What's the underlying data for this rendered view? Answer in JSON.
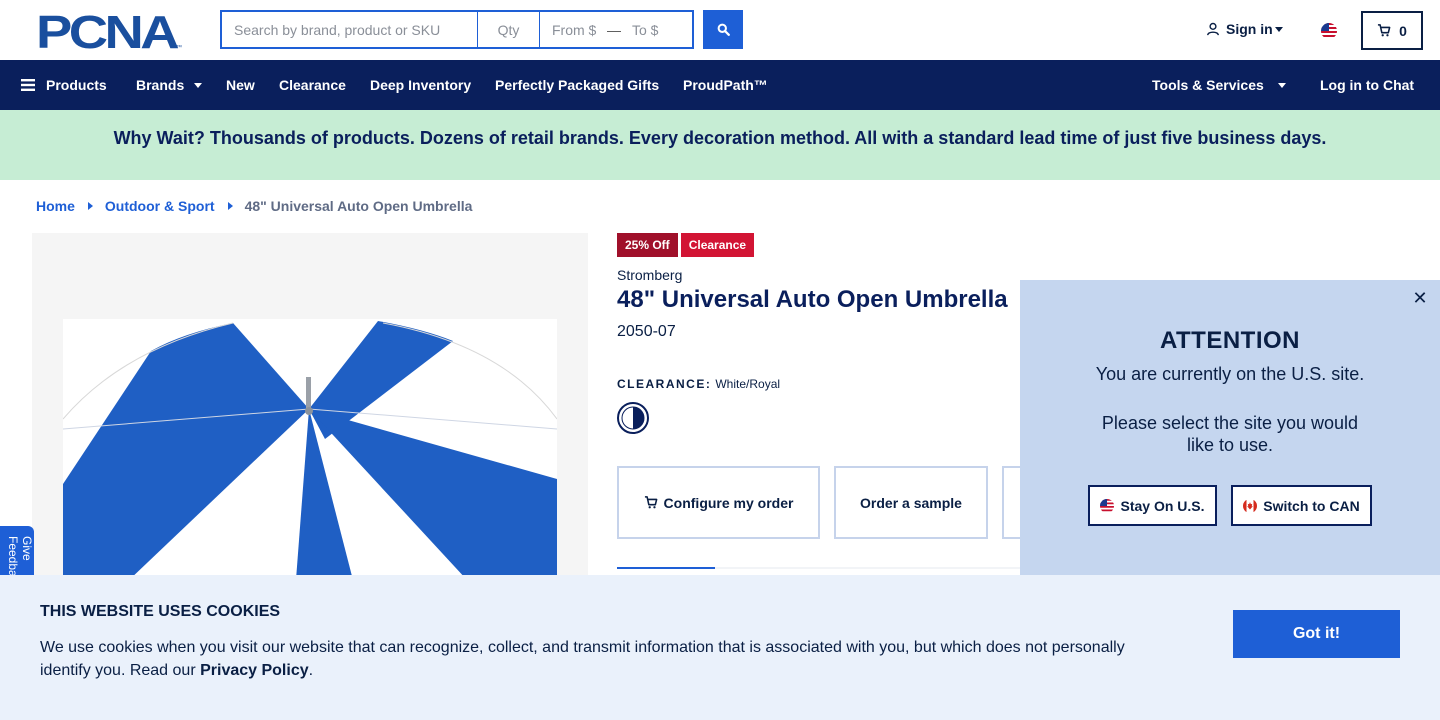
{
  "header": {
    "logo_text": "PCNA",
    "search_placeholder": "Search by brand, product or SKU",
    "qty_placeholder": "Qty",
    "from_placeholder": "From $",
    "dash": "—",
    "to_placeholder": "To $",
    "signin_label": "Sign in",
    "cart_count": "0"
  },
  "nav": {
    "items": [
      "Products",
      "Brands",
      "New",
      "Clearance",
      "Deep Inventory",
      "Perfectly Packaged Gifts",
      "ProudPath™"
    ],
    "right_items": [
      "Tools & Services",
      "Log in to Chat"
    ]
  },
  "promo": {
    "text": "Why Wait? Thousands of products. Dozens of retail brands. Every decoration method. All with a standard lead time of just five business days."
  },
  "breadcrumb": {
    "home": "Home",
    "category": "Outdoor & Sport",
    "current": "48\" Universal Auto Open Umbrella"
  },
  "feedback": {
    "label": "Give Feedback"
  },
  "product": {
    "badge_off": "25% Off",
    "badge_clearance": "Clearance",
    "brand": "Stromberg",
    "title": "48\" Universal Auto Open Umbrella",
    "sku": "2050-07",
    "clearance_label": "CLEARANCE:",
    "color_value": "White/Royal",
    "configure_label": "Configure my order",
    "sample_label": "Order a sample"
  },
  "attention": {
    "title": "ATTENTION",
    "line1": "You are currently on the U.S. site.",
    "line2": "Please select the site you would like to use.",
    "stay_label": "Stay On U.S.",
    "switch_label": "Switch to CAN"
  },
  "cookie": {
    "title": "THIS WEBSITE USES COOKIES",
    "text": "We use cookies when you visit our website that can recognize, collect, and transmit information that is associated with you, but which does not personally identify you. Read our ",
    "link": "Privacy Policy",
    "period": ".",
    "button": "Got it!"
  },
  "colors": {
    "navy": "#0a1f5c",
    "blue": "#1e5fd6",
    "promo_bg": "#c6edd4",
    "badge_off": "#a0102a",
    "badge_clearance": "#d21434",
    "modal_bg": "#c5d6ef",
    "cookie_bg": "#eaf1fb"
  }
}
